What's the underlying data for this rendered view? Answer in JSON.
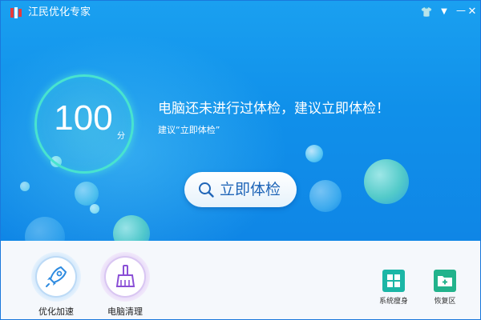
{
  "app": {
    "title": "江民优化专家"
  },
  "window_controls": [
    {
      "name": "skin-button",
      "glyph": "👕"
    },
    {
      "name": "menu-button",
      "glyph": "▼"
    },
    {
      "name": "minimize-button",
      "glyph": "—"
    },
    {
      "name": "close-button",
      "glyph": "✕"
    }
  ],
  "score": {
    "value": "100",
    "unit": "分"
  },
  "message": {
    "headline": "电脑还未进行过体检，建议立即体检！",
    "sub": "建议“立即体检”"
  },
  "check_button": {
    "label": "立即体检"
  },
  "features": [
    {
      "label": "优化加速",
      "icon": "rocket-icon"
    },
    {
      "label": "电脑清理",
      "icon": "broom-icon"
    }
  ],
  "tools": [
    {
      "label": "系统瘦身",
      "icon": "windows-icon",
      "color": "#1bb6a6"
    },
    {
      "label": "恢复区",
      "icon": "folder-plus-icon",
      "color": "#22b38c"
    }
  ],
  "colors": {
    "brand_blue": "#1090ea",
    "ring": "#48e3cf",
    "button_text": "#2066b8"
  }
}
